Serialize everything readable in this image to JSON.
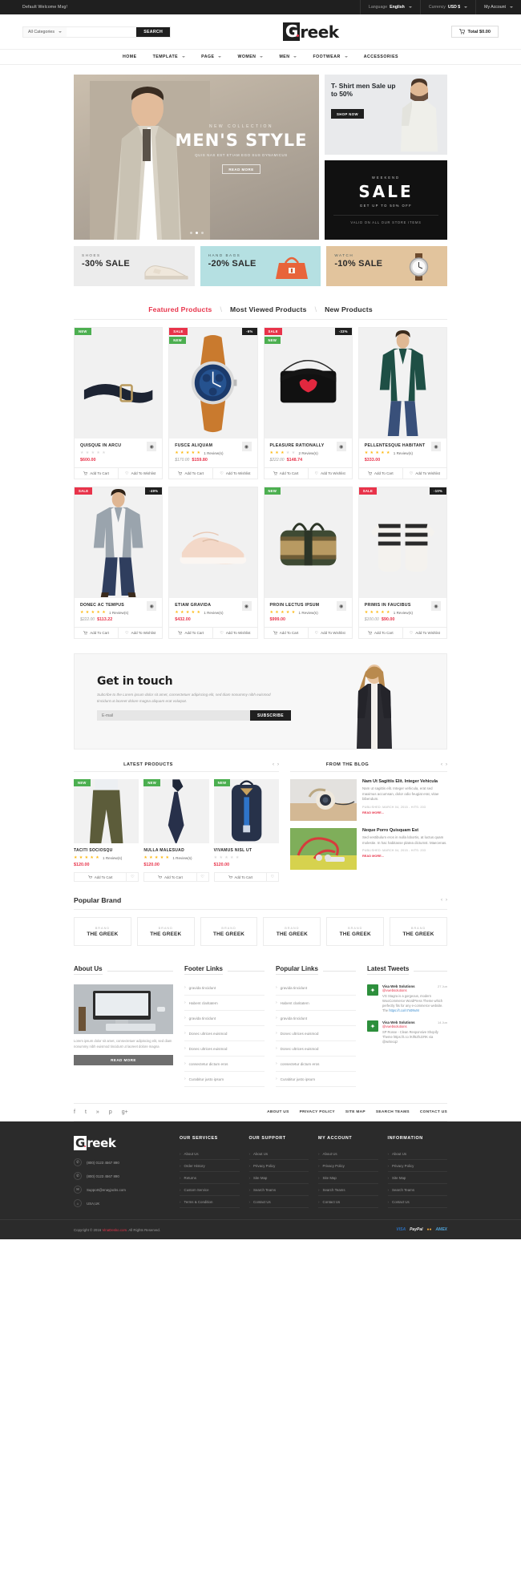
{
  "topbar": {
    "welcome": "Default Welcome Msg!",
    "language_label": "Language",
    "language_value": "English",
    "currency_label": "Currency",
    "currency_value": "USD $",
    "account": "My Account"
  },
  "header": {
    "category_select": "All Categories",
    "search_placeholder": "",
    "search_button": "SEARCH",
    "logo_first": "G",
    "logo_rest": "reek",
    "cart_label": "Total $0.00"
  },
  "nav": {
    "items": [
      {
        "label": "HOME",
        "has_caret": false
      },
      {
        "label": "TEMPLATE",
        "has_caret": true
      },
      {
        "label": "PAGE",
        "has_caret": true
      },
      {
        "label": "WOMEN",
        "has_caret": true
      },
      {
        "label": "MEN",
        "has_caret": true
      },
      {
        "label": "FOOTWEAR",
        "has_caret": true
      },
      {
        "label": "ACCESSORIES",
        "has_caret": false
      }
    ]
  },
  "hero": {
    "kicker": "NEW COLLECTION",
    "title": "MEN'S STYLE",
    "desc": "QUIS NAS EST ETIAM EGO SUS DYNAMICUS",
    "button": "READ MORE",
    "slide_count": 3,
    "active_slide": 2
  },
  "promo_tshirt": {
    "title": "T- Shirt men Sale up to 50%",
    "button": "SHOP NOW"
  },
  "promo_sale": {
    "kicker": "WEEKEND",
    "big": "SALE",
    "sub": "GET UP TO 50% OFF",
    "valid": "VALID ON ALL OUR STORE ITEMS"
  },
  "banners": [
    {
      "small": "SHOES",
      "big": "-30% SALE",
      "icon": "shoe-icon"
    },
    {
      "small": "HAND BAGS",
      "big": "-20% SALE",
      "icon": "handbag-icon"
    },
    {
      "small": "WATCH",
      "big": "-10% SALE",
      "icon": "watch-icon"
    }
  ],
  "tabs": [
    {
      "label": "Featured Products",
      "active": true
    },
    {
      "label": "Most Viewed Products",
      "active": false
    },
    {
      "label": "New Products",
      "active": false
    }
  ],
  "products_row1": [
    {
      "name": "QUISQUE IN ARCU",
      "stars": 0,
      "reviews": "",
      "price": "$600.00",
      "old_price": "",
      "badges": [
        {
          "text": "NEW",
          "type": "new"
        }
      ],
      "image": "belt",
      "add_cart": "Add To Cart",
      "wishlist": "Add To Wishlist"
    },
    {
      "name": "FUSCE ALIQUAM",
      "stars": 5,
      "reviews": "1 Review(s)",
      "price": "$159.80",
      "old_price": "$170.00",
      "badges": [
        {
          "text": "SALE",
          "type": "sale"
        },
        {
          "text": "NEW",
          "type": "new2"
        },
        {
          "text": "-6%",
          "type": "disc"
        }
      ],
      "image": "watch",
      "add_cart": "Add To Cart",
      "wishlist": "Add To Wishlist"
    },
    {
      "name": "PLEASURE RATIONALLY",
      "stars": 3,
      "reviews": "2 Review(s)",
      "price": "$148.74",
      "old_price": "$222.00",
      "badges": [
        {
          "text": "SALE",
          "type": "sale"
        },
        {
          "text": "NEW",
          "type": "new2"
        },
        {
          "text": "-33%",
          "type": "disc"
        }
      ],
      "image": "clutch",
      "add_cart": "Add To Cart",
      "wishlist": "Add To Wishlist"
    },
    {
      "name": "PELLENTESQUE HABITANT",
      "stars": 5,
      "reviews": "1 Review(s)",
      "price": "$333.00",
      "old_price": "",
      "badges": [],
      "image": "jacketman",
      "add_cart": "Add To Cart",
      "wishlist": "Add To Wishlist"
    }
  ],
  "products_row2": [
    {
      "name": "DONEC AC TEMPUS",
      "stars": 5,
      "reviews": "1 Review(s)",
      "price": "$113.22",
      "old_price": "$222.00",
      "badges": [
        {
          "text": "SALE",
          "type": "sale"
        },
        {
          "text": "-49%",
          "type": "disc"
        }
      ],
      "image": "blazerman",
      "add_cart": "Add To Cart",
      "wishlist": "Add To Wishlist"
    },
    {
      "name": "ETIAM GRAVIDA",
      "stars": 5,
      "reviews": "1 Review(s)",
      "price": "$432.00",
      "old_price": "",
      "badges": [],
      "image": "sneaker",
      "add_cart": "Add To Cart",
      "wishlist": "Add To Wishlist"
    },
    {
      "name": "PROIN LECTUS IPSUM",
      "stars": 5,
      "reviews": "1 Review(s)",
      "price": "$999.00",
      "old_price": "",
      "badges": [
        {
          "text": "NEW",
          "type": "new"
        }
      ],
      "image": "duffel",
      "add_cart": "Add To Cart",
      "wishlist": "Add To Wishlist"
    },
    {
      "name": "PRIMIS IN FAUCIBUS",
      "stars": 5,
      "reviews": "1 Review(s)",
      "price": "$90.00",
      "old_price": "$100.00",
      "badges": [
        {
          "text": "SALE",
          "type": "sale"
        },
        {
          "text": "-10%",
          "type": "disc"
        }
      ],
      "image": "gloves",
      "add_cart": "Add To Cart",
      "wishlist": "Add To Wishlist"
    }
  ],
  "newsletter": {
    "title": "Get in touch",
    "desc": "Subcribe to the Lorem ipsum dolor sit amet, consectetuer adipiscing elit, sed diam nonummy nibh euismod tincidunt ut laoreet dolore magna aliquam erat volutpat.",
    "placeholder": "E-mail",
    "button": "SUBSCRIBE"
  },
  "latest_products": {
    "heading": "LATEST PRODUCTS",
    "items": [
      {
        "name": "TACITI SOCIOSQU",
        "stars": 5,
        "reviews": "1 Review(s)",
        "price": "$120.00",
        "badge": "NEW",
        "image": "chinos",
        "add_cart": "Add To Cart"
      },
      {
        "name": "NULLA MALESUAD",
        "stars": 5,
        "reviews": "1 Review(s)",
        "price": "$120.00",
        "badge": "NEW",
        "image": "tie",
        "add_cart": "Add To Cart"
      },
      {
        "name": "VIVAMUS NISL UT",
        "stars": 0,
        "reviews": "",
        "price": "$120.00",
        "badge": "NEW",
        "image": "backpack",
        "add_cart": "Add To Cart"
      }
    ]
  },
  "blog": {
    "heading": "FROM THE BLOG",
    "posts": [
      {
        "title": "Nam Ut Sagittis Elit. Integer Vehicula",
        "text": "Nam ut sagittis elit. Integer vehicula, erat sed maximus accumsan, dolor odio feugiat erat, vitae bibendum.",
        "meta": "PUBLISHED: MARCH 04, 2015 - HITS: 203",
        "more": "READ MORE...",
        "image": "headphones"
      },
      {
        "title": "Neque Porro Quisquam Est",
        "text": "Sed vestibulum eros in nulla lobortis, at luctus quam molestie. In hac habitasse platea dictumst. Maecenas.",
        "meta": "PUBLISHED: MARCH 04, 2015 - HITS: 203",
        "more": "READ MORE...",
        "image": "earbuds"
      }
    ]
  },
  "brands": {
    "heading": "Popular Brand",
    "items": [
      {
        "small": "BRAND",
        "name": "THE GREEK"
      },
      {
        "small": "BRAND",
        "name": "THE GREEK"
      },
      {
        "small": "BRAND",
        "name": "THE GREEK"
      },
      {
        "small": "BRAND",
        "name": "THE GREEK"
      },
      {
        "small": "BRAND",
        "name": "THE GREEK"
      },
      {
        "small": "BRAND",
        "name": "THE GREEK"
      }
    ]
  },
  "about": {
    "heading": "About Us",
    "text": "Lorem ipsum dolor sit amet, consectetuer adipiscing elit, sed diam nonummy nibh euismod tincidunt ut laoreet dolore magna",
    "button": "READ MORE"
  },
  "footer_links": {
    "heading": "Footer Links",
    "items": [
      "gravida tincidunt",
      "Habent claritatem",
      "gravida tincidunt",
      "Donec ultrices euismod",
      "Donec ultrices euismod",
      "consectetur dictum eros",
      "Curabitur justo ipsum"
    ]
  },
  "popular_links": {
    "heading": "Popular Links",
    "items": [
      "gravida tincidunt",
      "Habent claritatem",
      "gravida tincidunt",
      "Donec ultrices euismod",
      "Donec ultrices euismod",
      "consectetur dictum eros",
      "Curabitur justo ipsum"
    ]
  },
  "tweets": {
    "heading": "Latest Tweets",
    "items": [
      {
        "name": "Visa Web Solutions",
        "handle": "@vwebsolutions",
        "date": "27 Jun",
        "text": "VG Stagra is a gorgeous, modern WooCommerce WordPress Theme which perfectly fits for any e-commerce website. The",
        "link": "https://t.co/n7n0NvM"
      },
      {
        "name": "Visa Web Solutions",
        "handle": "@vwebsolutions",
        "date": "14 Jun",
        "text": "SP Rosse - Clean Responsive Shopify Theme https://t.co /KIf6ZhJzRK via @writecqz",
        "link": ""
      }
    ]
  },
  "social_strip": {
    "icons": [
      "facebook-icon",
      "twitter-icon",
      "rss-icon",
      "pinterest-icon",
      "google-plus-icon"
    ],
    "links": [
      "ABOUT US",
      "PRIVACY POLICY",
      "SITE MAP",
      "SEARCH TEAMS",
      "CONTACT US"
    ]
  },
  "dark_footer": {
    "logo_first": "G",
    "logo_rest": "reek",
    "contacts": [
      {
        "icon": "phone-icon",
        "text": "(800) 0123 4567 890"
      },
      {
        "icon": "fax-icon",
        "text": "(800) 0123 4567 890"
      },
      {
        "icon": "mail-icon",
        "text": "Support@enayjacks.com"
      },
      {
        "icon": "location-icon",
        "text": "USA,UK"
      }
    ],
    "columns": [
      {
        "title": "OUR SERVICES",
        "items": [
          "About Us",
          "Order History",
          "Returns",
          "Custom Service",
          "Terms & Condition"
        ]
      },
      {
        "title": "OUR SUPPORT",
        "items": [
          "About Us",
          "Privacy Policy",
          "Site Map",
          "Search Teams",
          "Contact Us"
        ]
      },
      {
        "title": "MY ACCOUNT",
        "items": [
          "About Us",
          "Privacy Policy",
          "Site Map",
          "Search Teams",
          "Contact Us"
        ]
      },
      {
        "title": "INFORMATION",
        "items": [
          "About Us",
          "Privacy Policy",
          "Site Map",
          "Search Teams",
          "Contact Us"
        ]
      }
    ]
  },
  "copyright": {
    "text_pre": "Copyright © 2016 ",
    "brand": "VinaDesko.com",
    "text_post": ". All Rights Reserved.",
    "payments": [
      "VISA",
      "PayPal",
      "MC",
      "AMEX"
    ]
  },
  "colors": {
    "accent": "#e8334a",
    "dark": "#2b2b2b",
    "star": "#fdb913",
    "green": "#4caf50"
  }
}
